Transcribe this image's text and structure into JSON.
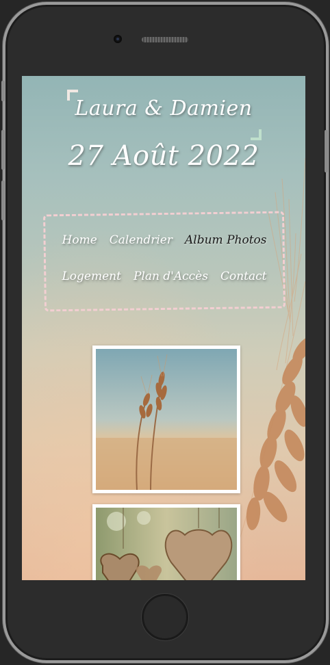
{
  "site": {
    "names": "Laura & Damien",
    "date": "27 Août 2022"
  },
  "nav": {
    "row1": [
      {
        "label": "Home",
        "active": false
      },
      {
        "label": "Calendrier",
        "active": false
      },
      {
        "label": "Album Photos",
        "active": true
      }
    ],
    "row2": [
      {
        "label": "Logement",
        "active": false
      },
      {
        "label": "Plan d'Accès",
        "active": false
      },
      {
        "label": "Contact",
        "active": false
      }
    ]
  },
  "colors": {
    "nav_border": "#f3cfd2",
    "corner_top_left": "#f1e8e3",
    "corner_bottom_right": "#bfe0cc"
  }
}
